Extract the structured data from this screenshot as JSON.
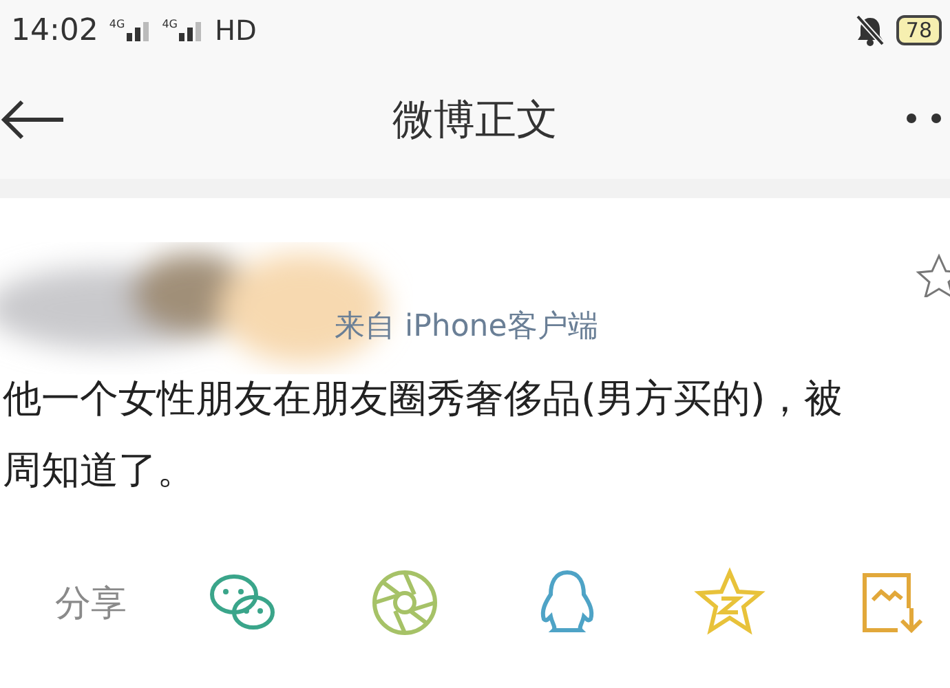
{
  "status_bar": {
    "time": "14:02",
    "networks": [
      "4G",
      "4G"
    ],
    "hd": "HD",
    "battery": "78",
    "muted": true
  },
  "nav_bar": {
    "title": "微博正文"
  },
  "post": {
    "source": "来自 iPhone客户端",
    "favorited": false,
    "lines": [
      "他一个女性朋友在朋友圈秀奢侈品(男方买的)，被",
      "周知道了。"
    ]
  },
  "share": {
    "label": "分享",
    "targets": [
      {
        "kind": "wechat",
        "color": "#3aa58a"
      },
      {
        "kind": "moments",
        "color": "#a6c267"
      },
      {
        "kind": "qq",
        "color": "#4ea3c6"
      },
      {
        "kind": "qzone",
        "color": "#e8c23a"
      },
      {
        "kind": "save",
        "color": "#e2a83a"
      }
    ]
  }
}
